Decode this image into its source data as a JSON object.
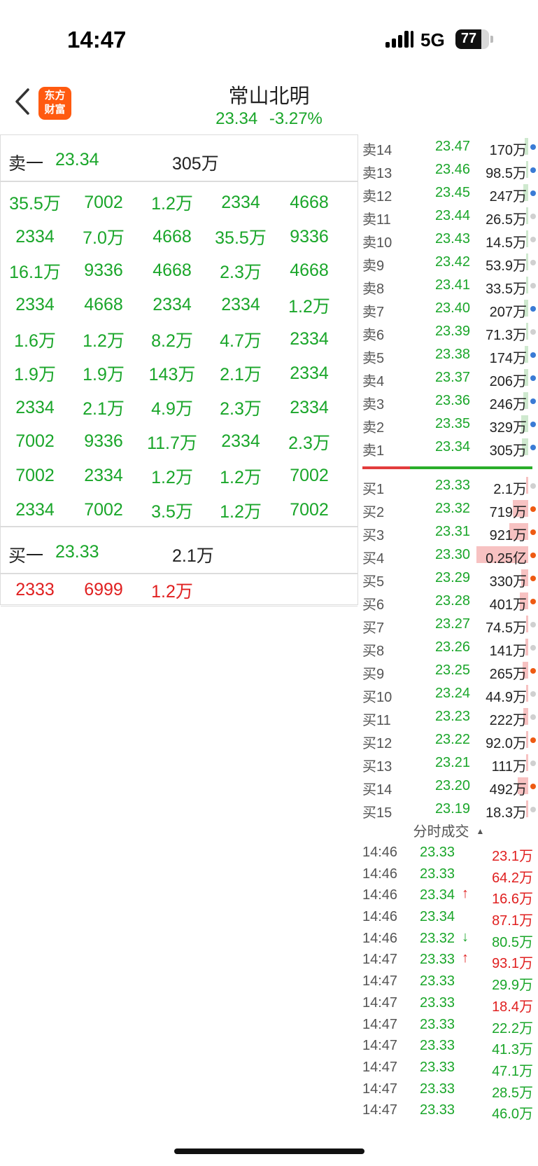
{
  "status_bar": {
    "time": "14:47",
    "network": "5G",
    "battery": "77",
    "battery_level": 0.77
  },
  "header": {
    "back_icon": "chevron-left-icon",
    "logo_line1": "东方",
    "logo_line2": "财富",
    "stock_name": "常山北明",
    "price": "23.34",
    "change_pct": "-3.27%"
  },
  "colors": {
    "up": "#e02020",
    "down": "#1aa62a",
    "blue_dot": "#3a7bd5",
    "orange_dot": "#ee5a12",
    "gray_dot": "#d0d0d0"
  },
  "ask_level1": {
    "label": "卖一",
    "price": "23.34",
    "volume": "305万"
  },
  "ask_queue": [
    [
      "35.5万",
      "7002",
      "1.2万",
      "2334",
      "4668"
    ],
    [
      "2334",
      "7.0万",
      "4668",
      "35.5万",
      "9336"
    ],
    [
      "16.1万",
      "9336",
      "4668",
      "2.3万",
      "4668"
    ],
    [
      "2334",
      "4668",
      "2334",
      "2334",
      "1.2万"
    ],
    [
      "1.6万",
      "1.2万",
      "8.2万",
      "4.7万",
      "2334"
    ],
    [
      "1.9万",
      "1.9万",
      "143万",
      "2.1万",
      "2334"
    ],
    [
      "2334",
      "2.1万",
      "4.9万",
      "2.3万",
      "2334"
    ],
    [
      "7002",
      "9336",
      "11.7万",
      "2334",
      "2.3万"
    ],
    [
      "7002",
      "2334",
      "1.2万",
      "1.2万",
      "7002"
    ],
    [
      "2334",
      "7002",
      "3.5万",
      "1.2万",
      "7002"
    ]
  ],
  "bid_level1": {
    "label": "买一",
    "price": "23.33",
    "volume": "2.1万"
  },
  "bid_queue": [
    "2333",
    "6999",
    "1.2万"
  ],
  "asks": [
    {
      "label": "卖14",
      "price": "23.47",
      "volume": "170万",
      "dot": "blue",
      "bar": 0.05
    },
    {
      "label": "卖13",
      "price": "23.46",
      "volume": "98.5万",
      "dot": "blue",
      "bar": 0.03
    },
    {
      "label": "卖12",
      "price": "23.45",
      "volume": "247万",
      "dot": "blue",
      "bar": 0.07
    },
    {
      "label": "卖11",
      "price": "23.44",
      "volume": "26.5万",
      "dot": "gray",
      "bar": 0.01
    },
    {
      "label": "卖10",
      "price": "23.43",
      "volume": "14.5万",
      "dot": "gray",
      "bar": 0.0
    },
    {
      "label": "卖9",
      "price": "23.42",
      "volume": "53.9万",
      "dot": "gray",
      "bar": 0.02
    },
    {
      "label": "卖8",
      "price": "23.41",
      "volume": "33.5万",
      "dot": "gray",
      "bar": 0.01
    },
    {
      "label": "卖7",
      "price": "23.40",
      "volume": "207万",
      "dot": "blue",
      "bar": 0.06
    },
    {
      "label": "卖6",
      "price": "23.39",
      "volume": "71.3万",
      "dot": "gray",
      "bar": 0.02
    },
    {
      "label": "卖5",
      "price": "23.38",
      "volume": "174万",
      "dot": "blue",
      "bar": 0.05
    },
    {
      "label": "卖4",
      "price": "23.37",
      "volume": "206万",
      "dot": "blue",
      "bar": 0.06
    },
    {
      "label": "卖3",
      "price": "23.36",
      "volume": "246万",
      "dot": "blue",
      "bar": 0.07
    },
    {
      "label": "卖2",
      "price": "23.35",
      "volume": "329万",
      "dot": "blue",
      "bar": 0.1
    },
    {
      "label": "卖1",
      "price": "23.34",
      "volume": "305万",
      "dot": "blue",
      "bar": 0.09
    }
  ],
  "bids": [
    {
      "label": "买1",
      "price": "23.33",
      "volume": "2.1万",
      "dot": "gray",
      "bar": 0.0
    },
    {
      "label": "买2",
      "price": "23.32",
      "volume": "719万",
      "dot": "orange",
      "bar": 0.22
    },
    {
      "label": "买3",
      "price": "23.31",
      "volume": "921万",
      "dot": "orange",
      "bar": 0.28
    },
    {
      "label": "买4",
      "price": "23.30",
      "volume": "0.25亿",
      "dot": "orange",
      "bar": 0.76
    },
    {
      "label": "买5",
      "price": "23.29",
      "volume": "330万",
      "dot": "orange",
      "bar": 0.1
    },
    {
      "label": "买6",
      "price": "23.28",
      "volume": "401万",
      "dot": "orange",
      "bar": 0.12
    },
    {
      "label": "买7",
      "price": "23.27",
      "volume": "74.5万",
      "dot": "gray",
      "bar": 0.02
    },
    {
      "label": "买8",
      "price": "23.26",
      "volume": "141万",
      "dot": "gray",
      "bar": 0.04
    },
    {
      "label": "买9",
      "price": "23.25",
      "volume": "265万",
      "dot": "orange",
      "bar": 0.08
    },
    {
      "label": "买10",
      "price": "23.24",
      "volume": "44.9万",
      "dot": "gray",
      "bar": 0.01
    },
    {
      "label": "买11",
      "price": "23.23",
      "volume": "222万",
      "dot": "gray",
      "bar": 0.07
    },
    {
      "label": "买12",
      "price": "23.22",
      "volume": "92.0万",
      "dot": "orange",
      "bar": 0.03
    },
    {
      "label": "买13",
      "price": "23.21",
      "volume": "111万",
      "dot": "gray",
      "bar": 0.03
    },
    {
      "label": "买14",
      "price": "23.20",
      "volume": "492万",
      "dot": "orange",
      "bar": 0.15
    },
    {
      "label": "买15",
      "price": "23.19",
      "volume": "18.3万",
      "dot": "gray",
      "bar": 0.01
    }
  ],
  "ticks_title": "分时成交",
  "ticks": [
    {
      "time": "14:46",
      "price": "23.33",
      "arrow": "",
      "volume": "23.1万",
      "dir": "up"
    },
    {
      "time": "14:46",
      "price": "23.33",
      "arrow": "",
      "volume": "64.2万",
      "dir": "up"
    },
    {
      "time": "14:46",
      "price": "23.34",
      "arrow": "↑",
      "volume": "16.6万",
      "dir": "up"
    },
    {
      "time": "14:46",
      "price": "23.34",
      "arrow": "",
      "volume": "87.1万",
      "dir": "up"
    },
    {
      "time": "14:46",
      "price": "23.32",
      "arrow": "↓",
      "volume": "80.5万",
      "dir": "down"
    },
    {
      "time": "14:47",
      "price": "23.33",
      "arrow": "↑",
      "volume": "93.1万",
      "dir": "up"
    },
    {
      "time": "14:47",
      "price": "23.33",
      "arrow": "",
      "volume": "29.9万",
      "dir": "down"
    },
    {
      "time": "14:47",
      "price": "23.33",
      "arrow": "",
      "volume": "18.4万",
      "dir": "up"
    },
    {
      "time": "14:47",
      "price": "23.33",
      "arrow": "",
      "volume": "22.2万",
      "dir": "down"
    },
    {
      "time": "14:47",
      "price": "23.33",
      "arrow": "",
      "volume": "41.3万",
      "dir": "down"
    },
    {
      "time": "14:47",
      "price": "23.33",
      "arrow": "",
      "volume": "47.1万",
      "dir": "down"
    },
    {
      "time": "14:47",
      "price": "23.33",
      "arrow": "",
      "volume": "28.5万",
      "dir": "down"
    },
    {
      "time": "14:47",
      "price": "23.33",
      "arrow": "",
      "volume": "46.0万",
      "dir": "down"
    }
  ]
}
